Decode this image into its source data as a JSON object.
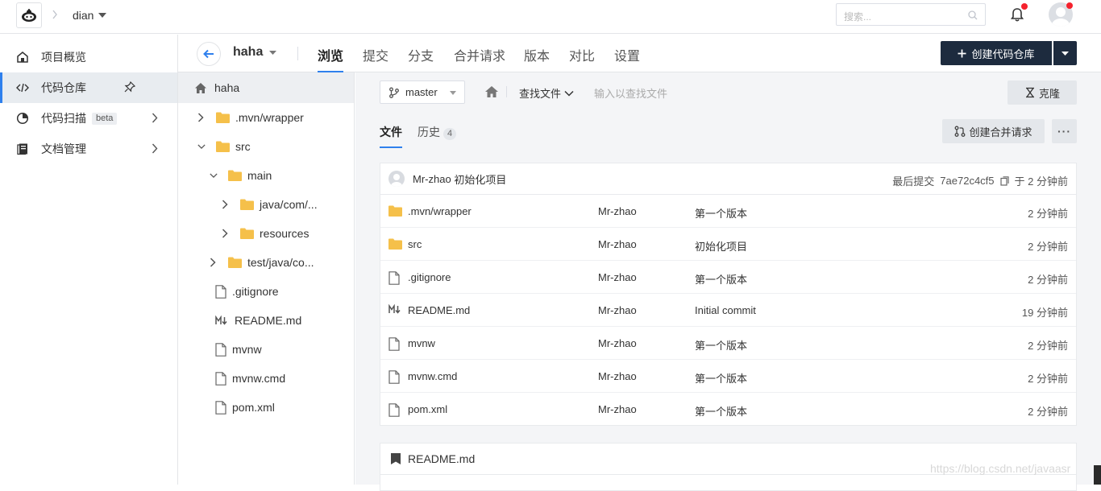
{
  "topbar": {
    "org_name": "dian",
    "search_placeholder": "搜索...",
    "colors": {
      "notification_dot": "#f5222d"
    }
  },
  "sidebar": {
    "items": [
      {
        "label": "项目概览",
        "icon": "home-icon"
      },
      {
        "label": "代码仓库",
        "icon": "code-icon",
        "active": true
      },
      {
        "label": "代码扫描",
        "icon": "scan-icon",
        "badge": "beta"
      },
      {
        "label": "文档管理",
        "icon": "book-icon"
      }
    ]
  },
  "repo": {
    "name": "haha",
    "tabs": [
      "浏览",
      "提交",
      "分支",
      "合并请求",
      "版本",
      "对比",
      "设置"
    ],
    "active_tab": "浏览",
    "create_button": "创建代码仓库"
  },
  "tree": {
    "root": "haha",
    "nodes": [
      {
        "label": ".mvn/wrapper",
        "type": "folder",
        "expanded": false
      },
      {
        "label": "src",
        "type": "folder",
        "expanded": true
      },
      {
        "label": "main",
        "type": "folder",
        "expanded": true
      },
      {
        "label": "java/com/...",
        "type": "folder",
        "expanded": false
      },
      {
        "label": "resources",
        "type": "folder",
        "expanded": false
      },
      {
        "label": "test/java/co...",
        "type": "folder",
        "expanded": false
      },
      {
        "label": ".gitignore",
        "type": "file"
      },
      {
        "label": "README.md",
        "type": "markdown"
      },
      {
        "label": "mvnw",
        "type": "file"
      },
      {
        "label": "mvnw.cmd",
        "type": "file"
      },
      {
        "label": "pom.xml",
        "type": "file"
      }
    ]
  },
  "toolbar": {
    "branch": "master",
    "find_file": "查找文件",
    "find_placeholder": "输入以查找文件",
    "clone": "克隆"
  },
  "subtabs": {
    "files": "文件",
    "history": "历史",
    "history_count": "4",
    "create_mr": "创建合并请求",
    "more": "···"
  },
  "last_commit": {
    "author": "Mr-zhao",
    "message": "初始化项目",
    "label": "最后提交",
    "hash": "7ae72c4cf5",
    "time": "于 2 分钟前"
  },
  "files": [
    {
      "name": ".mvn/wrapper",
      "type": "folder",
      "author": "Mr-zhao",
      "message": "第一个版本",
      "time": "2 分钟前"
    },
    {
      "name": "src",
      "type": "folder",
      "author": "Mr-zhao",
      "message": "初始化项目",
      "time": "2 分钟前"
    },
    {
      "name": ".gitignore",
      "type": "file",
      "author": "Mr-zhao",
      "message": "第一个版本",
      "time": "2 分钟前"
    },
    {
      "name": "README.md",
      "type": "markdown",
      "author": "Mr-zhao",
      "message": "Initial commit",
      "time": "19 分钟前"
    },
    {
      "name": "mvnw",
      "type": "file",
      "author": "Mr-zhao",
      "message": "第一个版本",
      "time": "2 分钟前"
    },
    {
      "name": "mvnw.cmd",
      "type": "file",
      "author": "Mr-zhao",
      "message": "第一个版本",
      "time": "2 分钟前"
    },
    {
      "name": "pom.xml",
      "type": "file",
      "author": "Mr-zhao",
      "message": "第一个版本",
      "time": "2 分钟前"
    }
  ],
  "readme": {
    "title": "README.md"
  },
  "watermark": "https://blog.csdn.net/javaasr",
  "colors": {
    "accent": "#2f80ed",
    "dark_button": "#1d2b3e",
    "folder": "#f5c04a"
  }
}
